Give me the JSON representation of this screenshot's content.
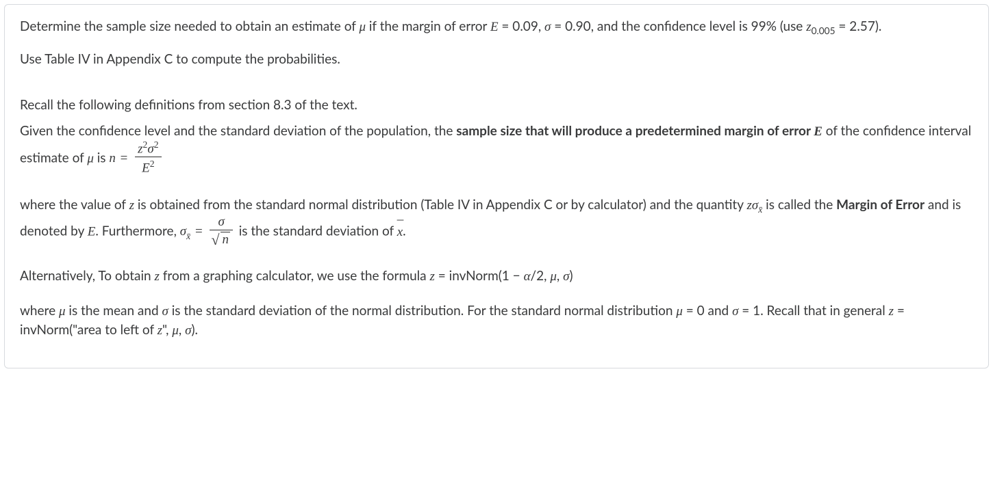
{
  "q": {
    "p1a": "Determine the sample size needed to obtain an estimate of ",
    "mu": "μ",
    "p1b": " if the margin of error ",
    "E": "E",
    "p1c": " = 0.09, ",
    "sigma": "σ",
    "p1d": " = 0.90, and the confidence level is 99% (use ",
    "zlabel": "z",
    "zsub": "0.005",
    "p1e": " = 2.57).",
    "p2": "Use Table IV in Appendix C to compute the probabilities."
  },
  "sol": {
    "l1": "Recall the following definitions from section 8.3 of the text.",
    "l2a": "Given the confidence level and the standard deviation of the population, the ",
    "l2b_bold": "sample size that will produce a predetermined margin of error ",
    "l2c_boldE": "E",
    "l2d": " of the confidence interval estimate of ",
    "l2e_mu": "μ",
    "l2f": " is ",
    "eq1": {
      "n": "n",
      "eq": "=",
      "z": "z",
      "sq": "2",
      "sigma": "σ",
      "E": "E"
    },
    "l3a": "where the value of ",
    "l3z": "z",
    "l3b": " is obtained from the standard normal distribution (Table IV in Appendix C or by calculator) and the quantity ",
    "l3c": " is called the ",
    "l3_bold": "Margin of Error",
    "l3d": " and is denoted by ",
    "l3E": "E",
    "l3e": ". Furthermore, ",
    "eq2": {
      "sigma": "σ",
      "x": "x̄",
      "eq": "=",
      "num_sigma": "σ",
      "n": "n"
    },
    "l3f": " is the standard deviation of ",
    "l3g": ".",
    "l4a": "Alternatively, To obtain ",
    "l4z": "z",
    "l4b": " from a graphing calculator, we use the formula ",
    "l4c": " = invNorm(1 − ",
    "l4alpha": "α",
    "l4d": "/2, ",
    "l4mu": "μ",
    "l4e": ", ",
    "l4sigma": "σ",
    "l4f": ")",
    "l5a": "where ",
    "l5mu": "μ",
    "l5b": " is the mean and ",
    "l5sigma": "σ",
    "l5c": " is the standard deviation of the normal distribution. For the standard normal distribution ",
    "l5d": " = 0 and ",
    "l5e": " = 1. Recall that in general ",
    "l5z": "z",
    "l5f": " = invNorm(\"area to left of ",
    "l5g": "\", ",
    "l5h": ", ",
    "l5i": ")."
  },
  "sym": {
    "sigma_xbar_sigma": "σ",
    "sigma_xbar_x": "x̄",
    "xbar_x": "x",
    "xbar_bar": "_"
  }
}
